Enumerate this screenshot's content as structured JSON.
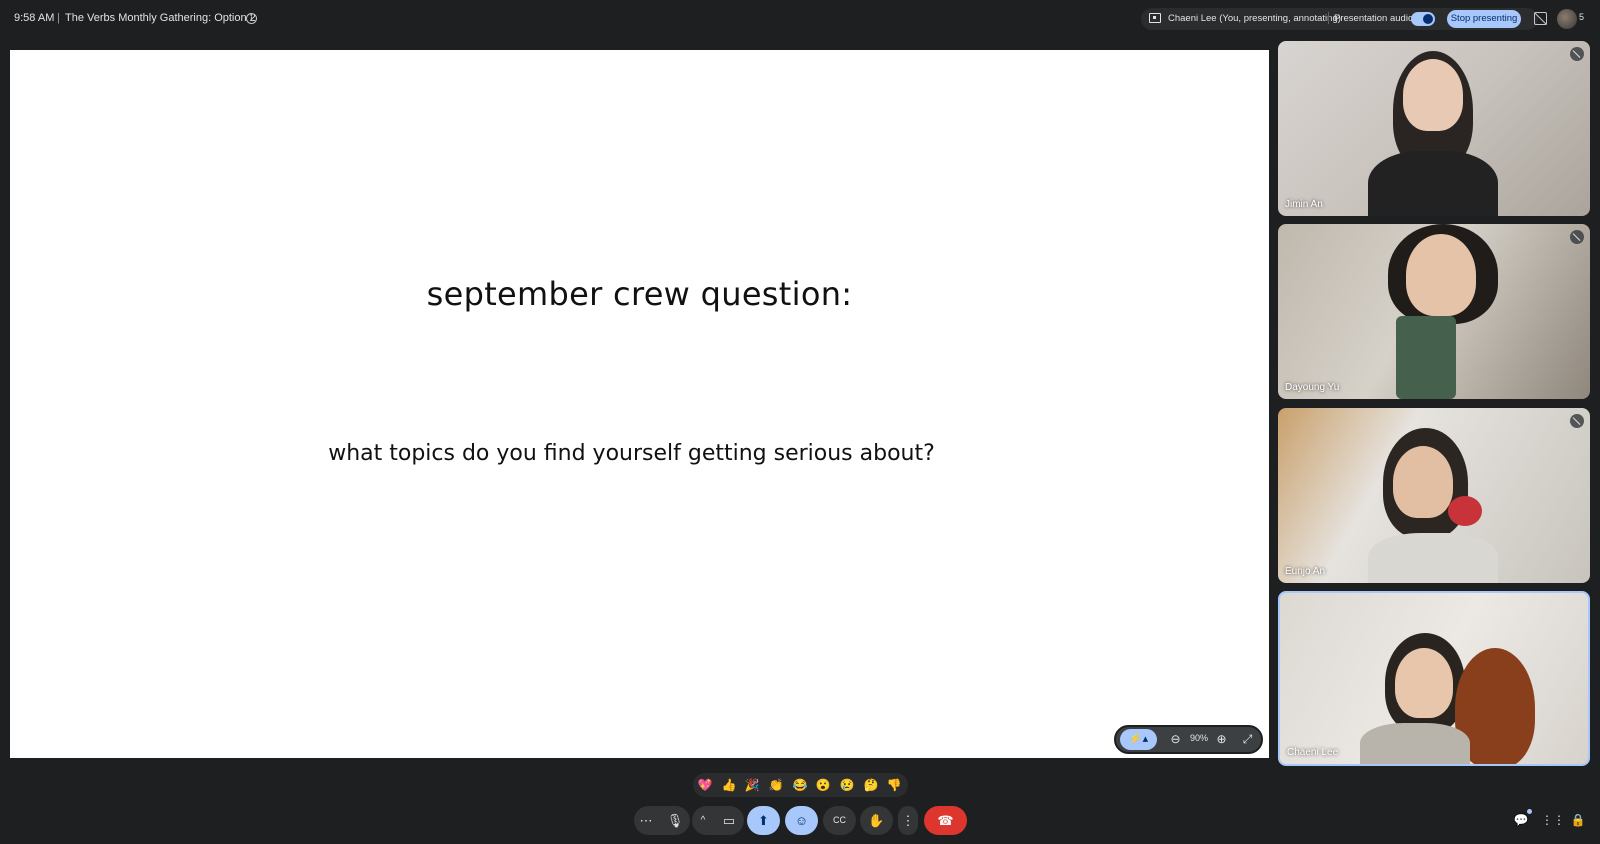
{
  "header": {
    "time": "9:58 AM",
    "separator": "|",
    "meeting_title": "The Verbs Monthly Gathering: Option 2",
    "info_icon": "i"
  },
  "presenting": {
    "label": "Chaeni Lee (You, presenting, annotating)",
    "audio_label": "Presentation audio",
    "audio_on": true,
    "stop_label": "Stop presenting",
    "people_count": "5"
  },
  "slide": {
    "title": "september crew question:",
    "question": "what topics do you find yourself getting serious about?",
    "toolbar": {
      "annotate_icon": "⚡▴",
      "zoom_out_icon": "⊖",
      "zoom_level": "90%",
      "zoom_in_icon": "⊕",
      "fullscreen_icon": "⤢"
    }
  },
  "participants": [
    {
      "name": "Jimin An",
      "muted": true
    },
    {
      "name": "Dayoung Yu",
      "muted": true
    },
    {
      "name": "Eunjo An",
      "muted": true
    },
    {
      "name": "Chaeni Lee",
      "muted": false
    }
  ],
  "reactions": [
    "💖",
    "👍",
    "🎉",
    "👏",
    "😂",
    "😮",
    "😢",
    "🤔",
    "👎"
  ],
  "controls": {
    "more_left": "⋯",
    "mic": "🎙",
    "caret": "^",
    "camera": "▭",
    "present": "⬆",
    "emoji": "☺",
    "captions": "CC",
    "hand": "✋",
    "more": "⋮",
    "leave": "☎"
  },
  "bottom_right": {
    "chat_icon": "💬",
    "apps_icon": "⋮⋮",
    "lock_icon": "🔒"
  },
  "colors": {
    "background": "#1e1f20",
    "accent": "#a8c7fa",
    "leave": "#dc362e"
  }
}
